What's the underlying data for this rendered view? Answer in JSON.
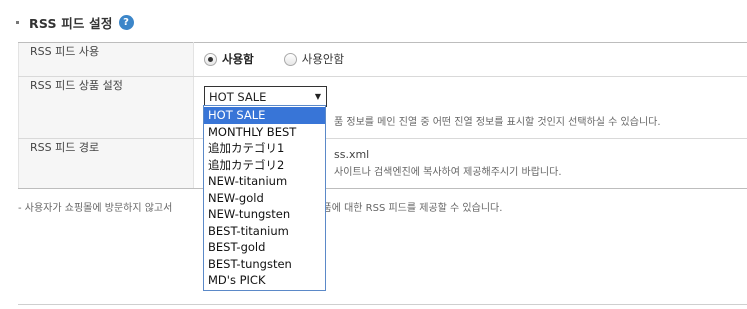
{
  "section": {
    "title": "RSS 피드 설정",
    "help_glyph": "?"
  },
  "rows": {
    "usage": {
      "label": "RSS 피드 사용",
      "options": [
        {
          "label": "사용함",
          "checked": true
        },
        {
          "label": "사용안함",
          "checked": false
        }
      ]
    },
    "product": {
      "label": "RSS 피드 상품 설정",
      "selected": "HOT SALE",
      "arrow": "▼",
      "description": "품 정보를 메인 진열 중 어떤 진열 정보를 표시할 것인지 선택하실 수 있습니다."
    },
    "path": {
      "label": "RSS 피드 경로",
      "value": "ss.xml",
      "description": "사이트나 검색엔진에 복사하여 제공해주시기 바랍니다."
    }
  },
  "note": {
    "left": "- 사용자가 쇼핑몰에 방문하지 않고서",
    "right": "도록 신규상품에 대한 RSS 피드를 제공할 수 있습니다."
  },
  "dropdown": {
    "options": [
      "HOT SALE",
      "MONTHLY BEST",
      "追加カテゴリ1",
      "追加カテゴリ2",
      "NEW-titanium",
      "NEW-gold",
      "NEW-tungsten",
      "BEST-titanium",
      "BEST-gold",
      "BEST-tungsten",
      "MD's PICK"
    ],
    "highlighted_index": 0
  },
  "colors": {
    "help_icon": "#3c86c9",
    "highlight": "#3875d7",
    "dropdown_border": "#5b89c8"
  }
}
